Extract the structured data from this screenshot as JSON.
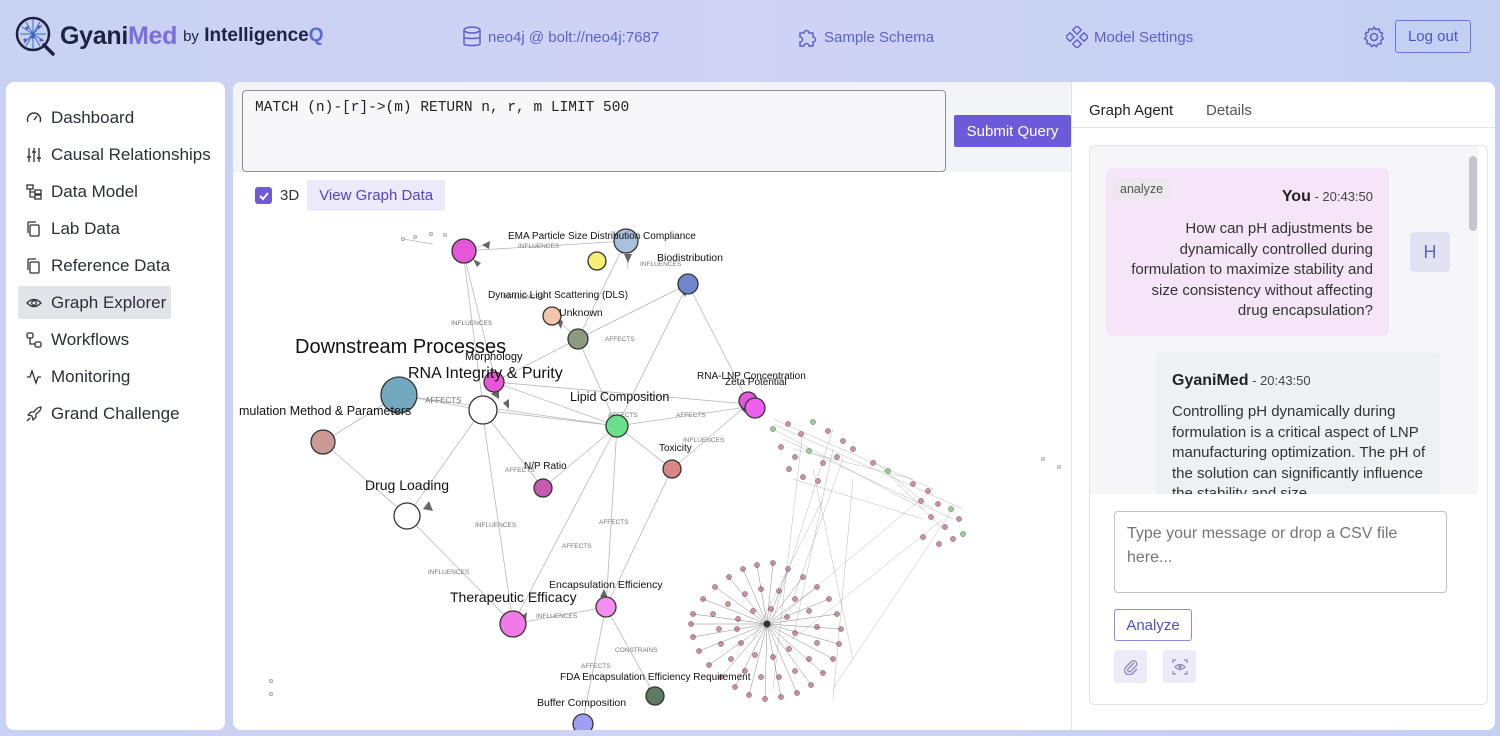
{
  "header": {
    "logo_gyani": "Gyani",
    "logo_med": "Med",
    "logo_by": "by",
    "logo_intelligence": "Intelligence",
    "logo_q": "Q",
    "connection": "neo4j @ bolt://neo4j:7687",
    "sample_schema": "Sample Schema",
    "model_settings": "Model Settings",
    "logout": "Log out"
  },
  "sidebar": {
    "items": [
      {
        "label": "Dashboard",
        "icon": "gauge-icon"
      },
      {
        "label": "Causal Relationships",
        "icon": "sliders-icon"
      },
      {
        "label": "Data Model",
        "icon": "hierarchy-icon"
      },
      {
        "label": "Lab Data",
        "icon": "copy-icon"
      },
      {
        "label": "Reference Data",
        "icon": "copy-icon"
      },
      {
        "label": "Graph Explorer",
        "icon": "eye-icon"
      },
      {
        "label": "Workflows",
        "icon": "workflow-icon"
      },
      {
        "label": "Monitoring",
        "icon": "activity-icon"
      },
      {
        "label": "Grand Challenge",
        "icon": "rocket-icon"
      }
    ],
    "active": "Graph Explorer"
  },
  "query": {
    "value": "MATCH (n)-[r]->(m) RETURN n, r, m LIMIT 500",
    "submit": "Submit Query",
    "toggle_3d": "3D",
    "toggle_3d_checked": true,
    "view_graph_data": "View Graph Data"
  },
  "graph": {
    "labels": {
      "downstream": "Downstream Processes",
      "rna": "RNA Integrity & Purity",
      "morphology": "Morphology",
      "formulation": "mulation Method & Parameters",
      "drug_loading": "Drug Loading",
      "np_ratio": "N/P Ratio",
      "lipid": "Lipid Composition",
      "toxicity": "Toxicity",
      "rna_lnp": "RNA-LNP Concentration",
      "zeta": "Zeta Potential",
      "ema": "EMA Particle Size Distribution Compliance",
      "biodist": "Biodistribution",
      "dls": "Dynamic Light Scattering (DLS)",
      "unknown": "Unknown",
      "therapeutic": "Therapeutic Efficacy",
      "encap": "Encapsulation Efficiency",
      "fda": "FDA Encapsulation Efficiency Requirement",
      "buffer": "Buffer Composition"
    },
    "edge_labels": {
      "influences": "INFLUENCES",
      "affects": "AFFECTS",
      "constrains": "CONSTRAINS"
    }
  },
  "agent": {
    "tabs": [
      "Graph Agent",
      "Details"
    ],
    "user_msg": {
      "tag": "analyze",
      "author": "You",
      "time": " - 20:43:50",
      "text": "How can pH adjustments be dynamically controlled during formulation to maximize stability and size consistency without affecting drug encapsulation?",
      "avatar": "H"
    },
    "bot_msg": {
      "author": "GyaniMed",
      "time": " - 20:43:50",
      "text": "Controlling pH dynamically during formulation is a critical aspect of LNP manufacturing optimization. The pH of the solution can significantly influence the stability and size"
    },
    "input_placeholder": "Type your message or drop a CSV file here...",
    "analyze_btn": "Analyze"
  },
  "colors": {
    "accent": "#6d5ad8",
    "link": "#5b62c9"
  }
}
